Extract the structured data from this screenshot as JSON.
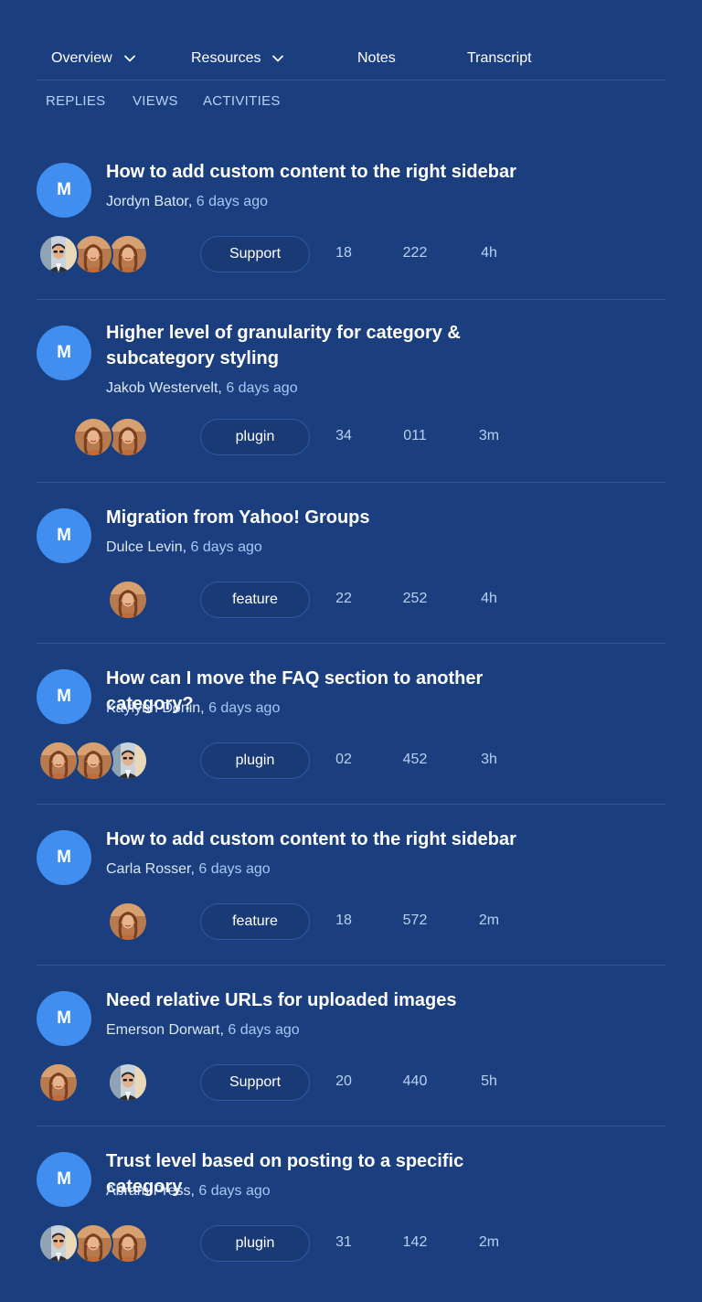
{
  "nav": {
    "items": [
      {
        "label": "Overview",
        "has_dropdown": true
      },
      {
        "label": "Resources",
        "has_dropdown": true
      },
      {
        "label": "Notes",
        "has_dropdown": false
      },
      {
        "label": "Transcript",
        "has_dropdown": false
      }
    ]
  },
  "tabs": [
    "REPLIES",
    "VIEWS",
    "ACTIVITIES"
  ],
  "colors": {
    "background": "#1b3f7e",
    "avatar": "#3f8ef0",
    "accent_text": "#a8c6f6"
  },
  "topics": [
    {
      "avatar_letter": "M",
      "title": "How to add custom content to the right sidebar",
      "author": "Jordyn Bator",
      "time_ago": "6 days ago",
      "participants": [
        "man",
        "woman",
        "woman"
      ],
      "tag": "Support",
      "replies": "18",
      "views": "222",
      "activity": "4h"
    },
    {
      "avatar_letter": "M",
      "title": "Higher level of granularity for category & subcategory styling",
      "author": "Jakob Westervelt",
      "time_ago": "6 days ago",
      "participants": [
        "woman",
        "woman"
      ],
      "tag": "plugin",
      "replies": "34",
      "views": "011",
      "activity": "3m"
    },
    {
      "avatar_letter": "M",
      "title": "Migration from Yahoo! Groups",
      "author": "Dulce Levin",
      "time_ago": "6 days ago",
      "participants": [
        "woman"
      ],
      "tag": "feature",
      "replies": "22",
      "views": "252",
      "activity": "4h"
    },
    {
      "avatar_letter": "M",
      "title": "How can I move the FAQ section to another category?",
      "author": "Kaylynn Donin",
      "time_ago": "6 days ago",
      "participants": [
        "woman",
        "woman",
        "man"
      ],
      "tag": "plugin",
      "replies": "02",
      "views": "452",
      "activity": "3h"
    },
    {
      "avatar_letter": "M",
      "title": "How to add custom content to the right sidebar",
      "author": "Carla Rosser",
      "time_ago": "6 days ago",
      "participants": [
        "woman"
      ],
      "tag": "feature",
      "replies": "18",
      "views": "572",
      "activity": "2m"
    },
    {
      "avatar_letter": "M",
      "title": "Need relative URLs for uploaded images",
      "author": "Emerson Dorwart",
      "time_ago": "6 days ago",
      "participants": [
        "woman",
        "man"
      ],
      "tag": "Support",
      "replies": "20",
      "views": "440",
      "activity": "5h"
    },
    {
      "avatar_letter": "M",
      "title": "Trust level based on posting to a specific category",
      "author": "Abram Press",
      "time_ago": "6 days ago",
      "participants": [
        "man",
        "woman",
        "woman"
      ],
      "tag": "plugin",
      "replies": "31",
      "views": "142",
      "activity": "2m"
    }
  ]
}
